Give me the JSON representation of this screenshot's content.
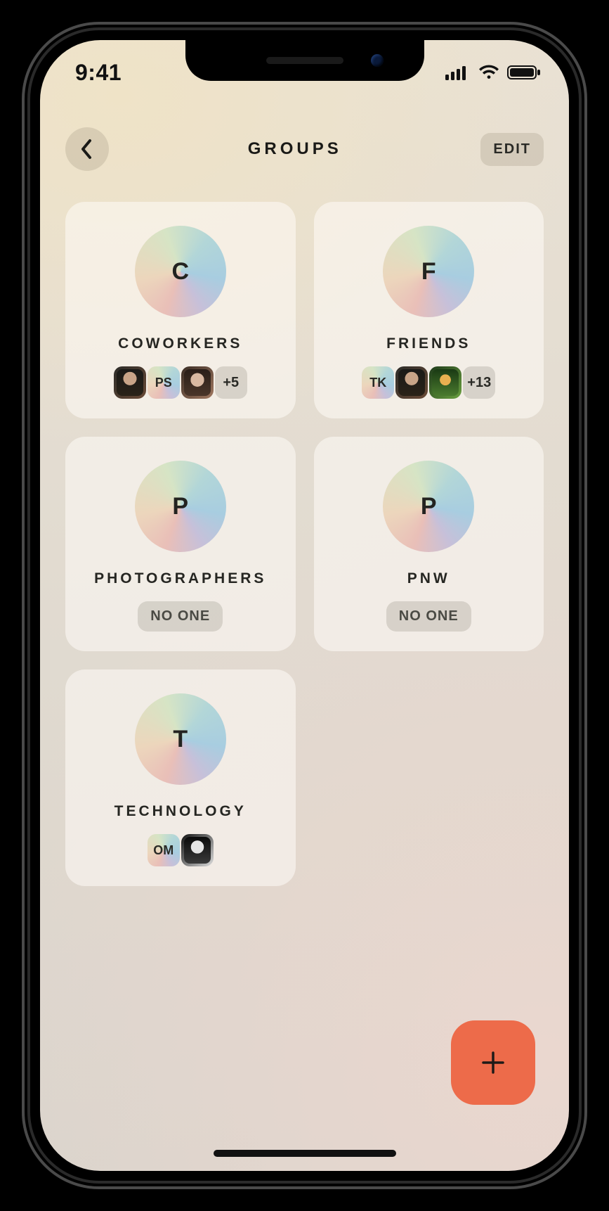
{
  "status": {
    "time": "9:41"
  },
  "header": {
    "title": "GROUPS",
    "edit": "EDIT"
  },
  "labels": {
    "no_one": "NO ONE"
  },
  "groups": [
    {
      "name": "COWORKERS",
      "initial": "C",
      "members": [
        {
          "kind": "photo",
          "style": "photo1"
        },
        {
          "kind": "initials",
          "text": "PS"
        },
        {
          "kind": "photo",
          "style": "photo2"
        }
      ],
      "more": "+5"
    },
    {
      "name": "FRIENDS",
      "initial": "F",
      "members": [
        {
          "kind": "initials",
          "text": "TK"
        },
        {
          "kind": "photo",
          "style": "photo1"
        },
        {
          "kind": "photo",
          "style": "photo3"
        }
      ],
      "more": "+13"
    },
    {
      "name": "PHOTOGRAPHERS",
      "initial": "P",
      "members": [],
      "more": null
    },
    {
      "name": "PNW",
      "initial": "P",
      "members": [],
      "more": null
    },
    {
      "name": "TECHNOLOGY",
      "initial": "T",
      "members": [
        {
          "kind": "initials",
          "text": "OM"
        },
        {
          "kind": "photo",
          "style": "photo4"
        }
      ],
      "more": null
    }
  ]
}
